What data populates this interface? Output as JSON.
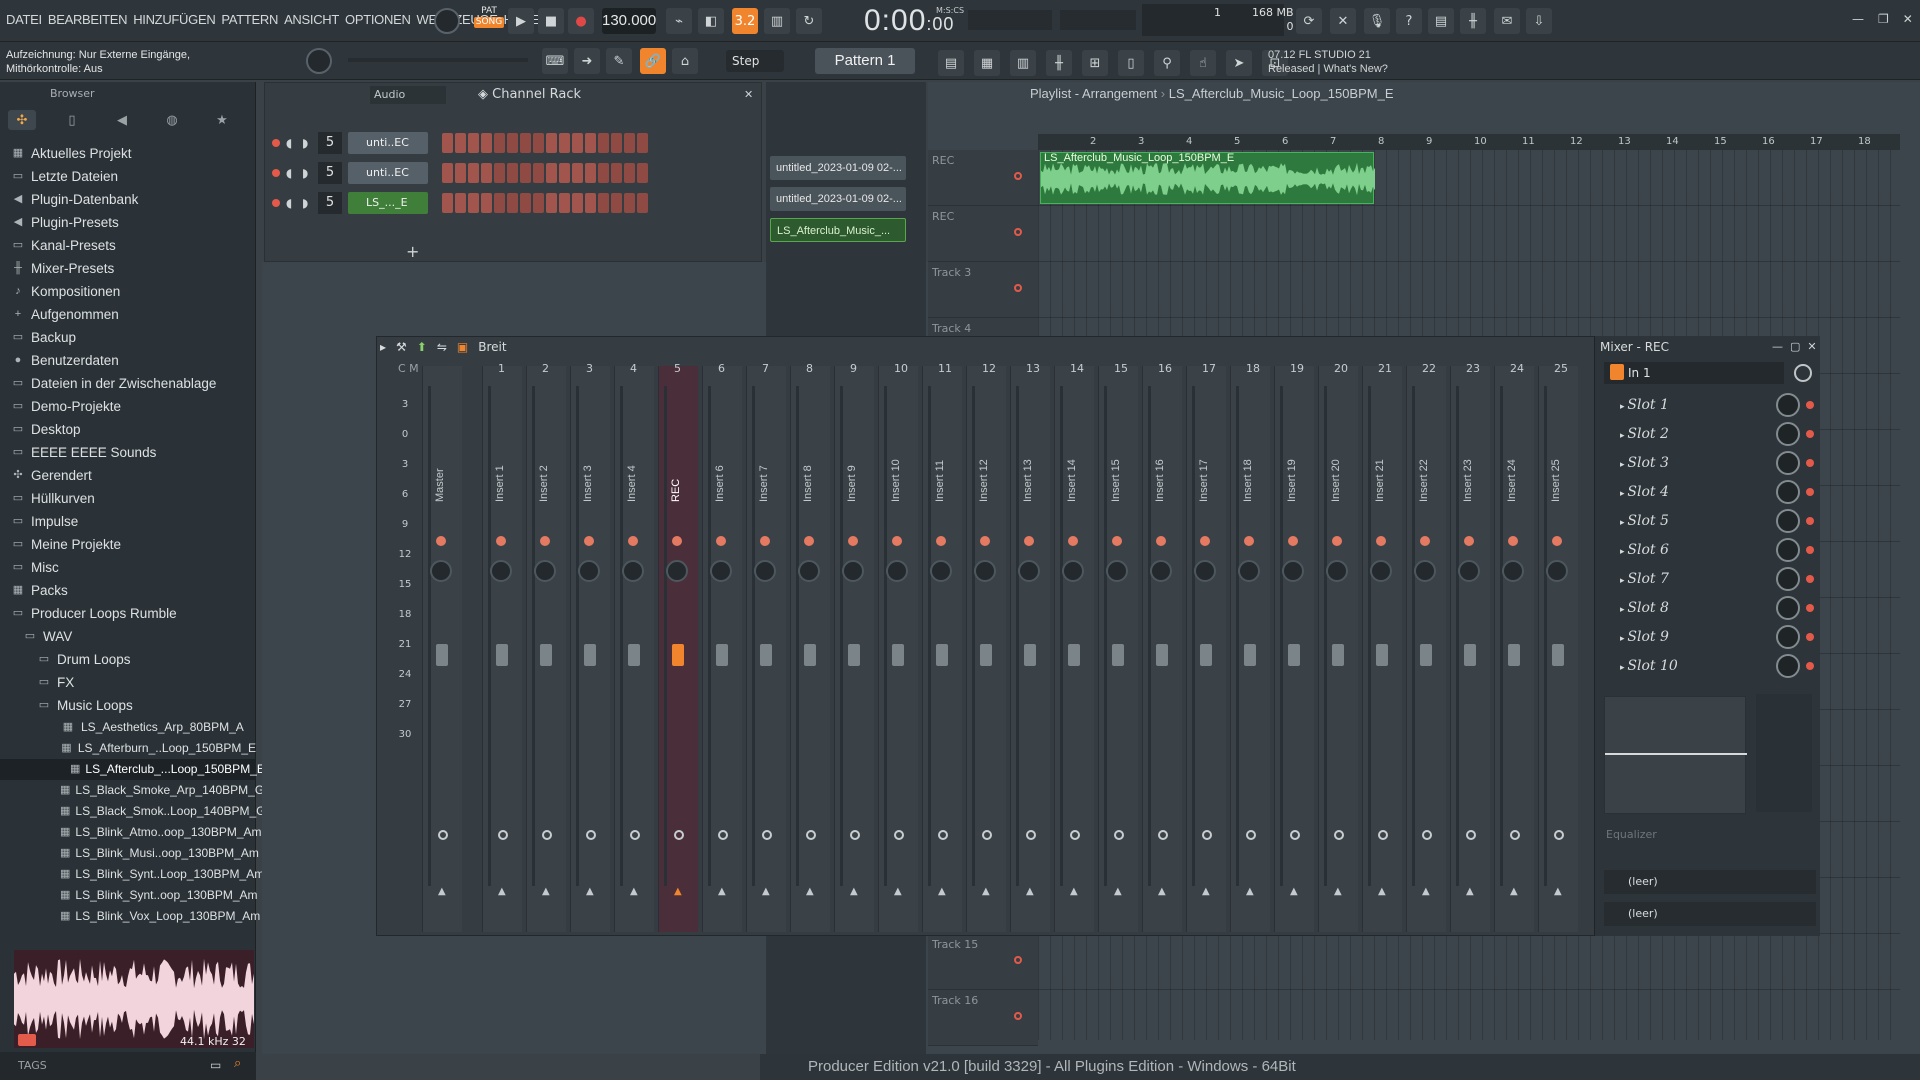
{
  "menu": [
    "DATEI",
    "BEARBEITEN",
    "HINZUFÜGEN",
    "PATTERN",
    "ANSICHT",
    "OPTIONEN",
    "WERKZEUGE",
    "HILFE"
  ],
  "toolbar": {
    "song_label": "SONG",
    "pat_label": "PAT",
    "tempo": "130.000",
    "timer_main": "0:00",
    "timer_frac": ":00",
    "timer_unit": "M:S:CS",
    "memory_mb": "168 MB",
    "cpu": "1",
    "voices": "0",
    "step_label": "Step",
    "pattern_label": "Pattern 1",
    "hint_line1": "Aufzeichnung: Nur Externe Eingänge,",
    "hint_line2": "Mithörkontrolle: Aus",
    "news_line1": "07.12  FL STUDIO 21",
    "news_line2": "Released | What's New?"
  },
  "browser": {
    "title": "Browser",
    "items": [
      {
        "label": "Aktuelles Projekt",
        "icon": "▦"
      },
      {
        "label": "Letzte Dateien",
        "icon": "▭"
      },
      {
        "label": "Plugin-Datenbank",
        "icon": "◀"
      },
      {
        "label": "Plugin-Presets",
        "icon": "◀"
      },
      {
        "label": "Kanal-Presets",
        "icon": "▭"
      },
      {
        "label": "Mixer-Presets",
        "icon": "╫"
      },
      {
        "label": "Kompositionen",
        "icon": "♪"
      },
      {
        "label": "Aufgenommen",
        "icon": "+"
      },
      {
        "label": "Backup",
        "icon": "▭"
      },
      {
        "label": "Benutzerdaten",
        "icon": "●"
      },
      {
        "label": "Dateien in der Zwischenablage",
        "icon": "▭"
      },
      {
        "label": "Demo-Projekte",
        "icon": "▭"
      },
      {
        "label": "Desktop",
        "icon": "▭"
      },
      {
        "label": "EEEE EEEE Sounds",
        "icon": "▭"
      },
      {
        "label": "Gerendert",
        "icon": "✣"
      },
      {
        "label": "Hüllkurven",
        "icon": "▭"
      },
      {
        "label": "Impulse",
        "icon": "▭"
      },
      {
        "label": "Meine Projekte",
        "icon": "▭"
      },
      {
        "label": "Misc",
        "icon": "▭"
      },
      {
        "label": "Packs",
        "icon": "▦"
      },
      {
        "label": "Producer Loops Rumble",
        "icon": "▭"
      },
      {
        "label": "WAV",
        "icon": "▭"
      },
      {
        "label": "Drum Loops",
        "icon": "▭"
      },
      {
        "label": "FX",
        "icon": "▭"
      },
      {
        "label": "Music Loops",
        "icon": "▭"
      }
    ],
    "files": [
      "LS_Aesthetics_Arp_80BPM_A",
      "LS_Afterburn_..Loop_150BPM_E",
      "LS_Afterclub_...Loop_150BPM_E",
      "LS_Black_Smoke_Arp_140BPM_G",
      "LS_Black_Smok..Loop_140BPM_G",
      "LS_Blink_Atmo..oop_130BPM_Am",
      "LS_Blink_Musi..oop_130BPM_Am",
      "LS_Blink_Synt..Loop_130BPM_Am",
      "LS_Blink_Synt..oop_130BPM_Am",
      "LS_Blink_Vox_Loop_130BPM_Am"
    ],
    "sample_info": "44.1 kHz 32",
    "tags_label": "TAGS"
  },
  "channel_rack": {
    "title": "Channel Rack",
    "filter": "Audio",
    "channels": [
      {
        "num": "5",
        "name": "unti..EC"
      },
      {
        "num": "5",
        "name": "unti..EC"
      },
      {
        "num": "5",
        "name": "LS_..._E"
      }
    ],
    "add": "+"
  },
  "patterns": [
    "untitled_2023-01-09 02-...",
    "untitled_2023-01-09 02-...",
    "LS_Afterclub_Music_..."
  ],
  "playlist": {
    "title": "Playlist - Arrangement",
    "clip_name": "LS_Afterclub_Music_Loop_150BPM_E",
    "ruler": [
      "2",
      "3",
      "4",
      "5",
      "6",
      "7",
      "8",
      "9",
      "10",
      "11",
      "12",
      "13",
      "14",
      "15",
      "16",
      "17",
      "18"
    ],
    "tracks": [
      "REC",
      "REC",
      "Track 3",
      "Track 4",
      "Track 15",
      "Track 16"
    ]
  },
  "mixer": {
    "title": "Breit",
    "panel_title": "Mixer - REC",
    "input": "In 1",
    "db_scale": [
      "3",
      "0",
      "3",
      "6",
      "9",
      "12",
      "15",
      "18",
      "21",
      "24",
      "27",
      "30"
    ],
    "header_cm": "C  M",
    "strips": [
      "Master",
      "Insert 1",
      "Insert 2",
      "Insert 3",
      "Insert 4",
      "REC",
      "Insert 6",
      "Insert 7",
      "Insert 8",
      "Insert 9",
      "Insert 10",
      "Insert 11",
      "Insert 12",
      "Insert 13",
      "Insert 14",
      "Insert 15",
      "Insert 16",
      "Insert 17",
      "Insert 18",
      "Insert 19",
      "Insert 20",
      "Insert 21",
      "Insert 22",
      "Insert 23",
      "Insert 24",
      "Insert 25"
    ],
    "numbers": [
      "1",
      "2",
      "3",
      "4",
      "5",
      "6",
      "7",
      "8",
      "9",
      "10",
      "11",
      "12",
      "13",
      "14",
      "15",
      "16",
      "17",
      "18",
      "19",
      "20",
      "21",
      "22",
      "23",
      "24",
      "25"
    ],
    "slots": [
      "Slot 1",
      "Slot 2",
      "Slot 3",
      "Slot 4",
      "Slot 5",
      "Slot 6",
      "Slot 7",
      "Slot 8",
      "Slot 9",
      "Slot 10"
    ],
    "eq_label": "Equalizer",
    "empty1": "(leer)",
    "empty2": "(leer)"
  },
  "status": "Producer Edition v21.0 [build 3329] - All Plugins Edition - Windows - 64Bit"
}
